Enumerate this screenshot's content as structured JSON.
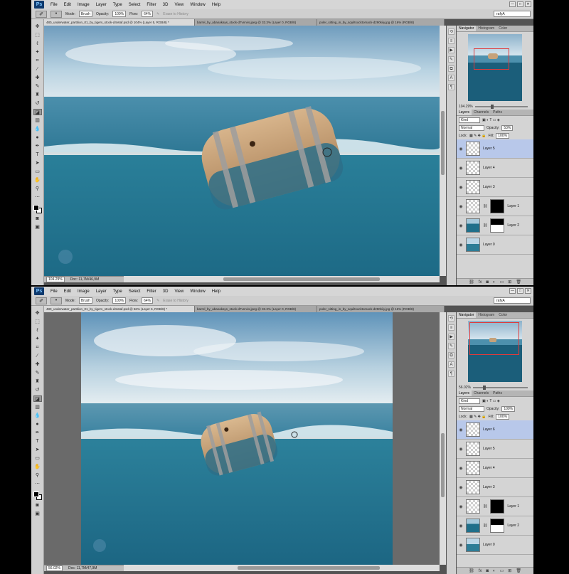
{
  "menu": [
    "File",
    "Edit",
    "Image",
    "Layer",
    "Type",
    "Select",
    "Filter",
    "3D",
    "View",
    "Window",
    "Help"
  ],
  "app_logo": "Ps",
  "window_controls": [
    "—",
    "□",
    "✕"
  ],
  "options": {
    "mode_label": "Mode:",
    "mode_value": "Brush",
    "opacity_label": "Opacity:",
    "opacity_value": "100%",
    "flow_label": "Flow:",
    "flow_value": "64%",
    "erase_history": "Erase to History",
    "workspace": "rafyA"
  },
  "screens": [
    {
      "tabs": [
        "480_underwater_partition_01_by_tigers_stock-d4v6af.psd @ 104% (Layer 5, RGB/8) *",
        "barrel_by_abanakays_stock-d7vnrvis.jpeg @ 33.3% (Layer 0, RGB/8)",
        "poler_sitting_in_by_squiltsocktomack-d290kiiy.jpg @ 16% (RGB/8)"
      ],
      "zoom": "104.29%",
      "doc": "Doc: 11,7M/46,9M",
      "nav_zoom": "104.29%",
      "opacity": "53%",
      "fill": "100%",
      "blend": "Normal",
      "kind": "Kind",
      "layers": [
        "Layer 5",
        "Layer 4",
        "Layer 3",
        "Layer 1",
        "Layer 2",
        "Layer 0"
      ],
      "active_layer": "Layer 5"
    },
    {
      "tabs": [
        "480_underwater_partition_01_by_tigers_stock-d4v6af.psd @ 56% (Layer 6, RGB/8) *",
        "barrel_by_abanakays_stock-d7vnrvis.jpeg @ 33.3% (Layer 0, RGB/8)",
        "poler_sitting_in_by_squiltsocktomack-d290kiiy.jpg @ 16% (RGB/8)"
      ],
      "zoom": "56.02%",
      "doc": "Doc: 11,7M/47,9M",
      "nav_zoom": "56.02%",
      "opacity": "100%",
      "fill": "100%",
      "blend": "Normal",
      "kind": "Kind",
      "layers": [
        "Layer 6",
        "Layer 5",
        "Layer 4",
        "Layer 3",
        "Layer 1",
        "Layer 2",
        "Layer 0"
      ],
      "active_layer": "Layer 6"
    }
  ],
  "panel_tabs": {
    "nav": [
      "Navigator",
      "Histogram",
      "Color"
    ],
    "layers": [
      "Layers",
      "Channels",
      "Paths"
    ]
  },
  "labels": {
    "lock": "Lock:",
    "opacity": "Opacity:",
    "fill": "Fill:"
  },
  "colors": {
    "sky_top": "#7fa9c7",
    "sea_surface": "#3d8aa8",
    "underwater": "#1f6f8b",
    "barrel_wood": "#c8a47a",
    "active_layer": "#b8c8ea"
  }
}
